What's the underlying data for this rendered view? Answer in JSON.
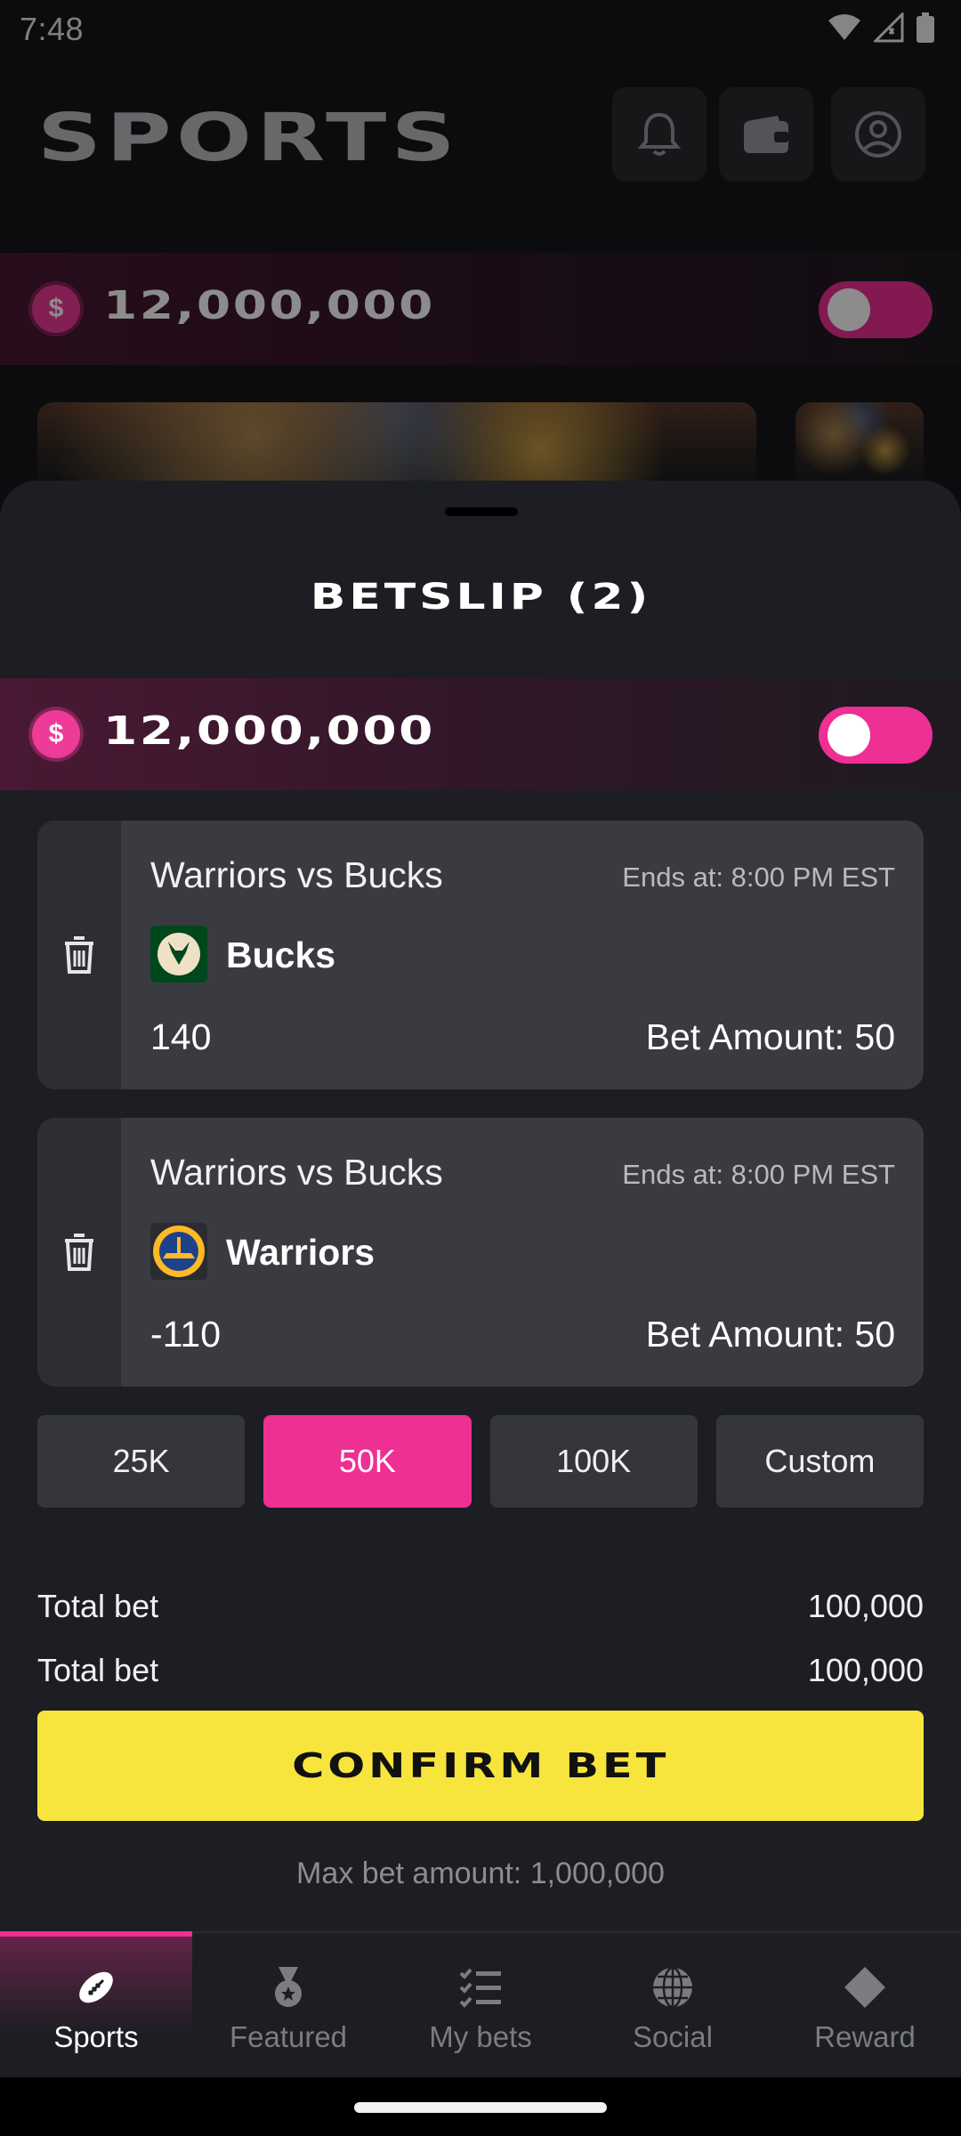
{
  "status_bar": {
    "time": "7:48"
  },
  "header": {
    "title": "SPORTS"
  },
  "balance": {
    "amount": "12,000,000",
    "coin_symbol": "$"
  },
  "betslip": {
    "title": "BETSLIP (2)",
    "bets": [
      {
        "matchup": "Warriors vs Bucks",
        "ends": "Ends at: 8:00 PM EST",
        "team": "Bucks",
        "odds": "140",
        "amount": "Bet Amount: 50",
        "logo_color": "#00471b"
      },
      {
        "matchup": "Warriors vs Bucks",
        "ends": "Ends at: 8:00 PM EST",
        "team": "Warriors",
        "odds": "-110",
        "amount": "Bet Amount: 50",
        "logo_color": "#1d428a"
      }
    ],
    "chips": [
      "25K",
      "50K",
      "100K",
      "Custom"
    ],
    "selected_chip": "50K",
    "totals": [
      {
        "label": "Total bet",
        "value": "100,000"
      },
      {
        "label": "Total bet",
        "value": "100,000"
      }
    ],
    "confirm_label": "CONFIRM BET",
    "max_bet": "Max bet amount: 1,000,000"
  },
  "nav": {
    "items": [
      {
        "label": "Sports",
        "icon": "football-icon",
        "active": true
      },
      {
        "label": "Featured",
        "icon": "medal-icon",
        "active": false
      },
      {
        "label": "My bets",
        "icon": "checklist-icon",
        "active": false
      },
      {
        "label": "Social",
        "icon": "globe-icon",
        "active": false
      },
      {
        "label": "Reward",
        "icon": "diamond-icon",
        "active": false
      }
    ]
  },
  "colors": {
    "accent": "#ee2f94",
    "confirm": "#f7e43d",
    "sheet": "#1c1e23",
    "card": "#3a3b41"
  }
}
